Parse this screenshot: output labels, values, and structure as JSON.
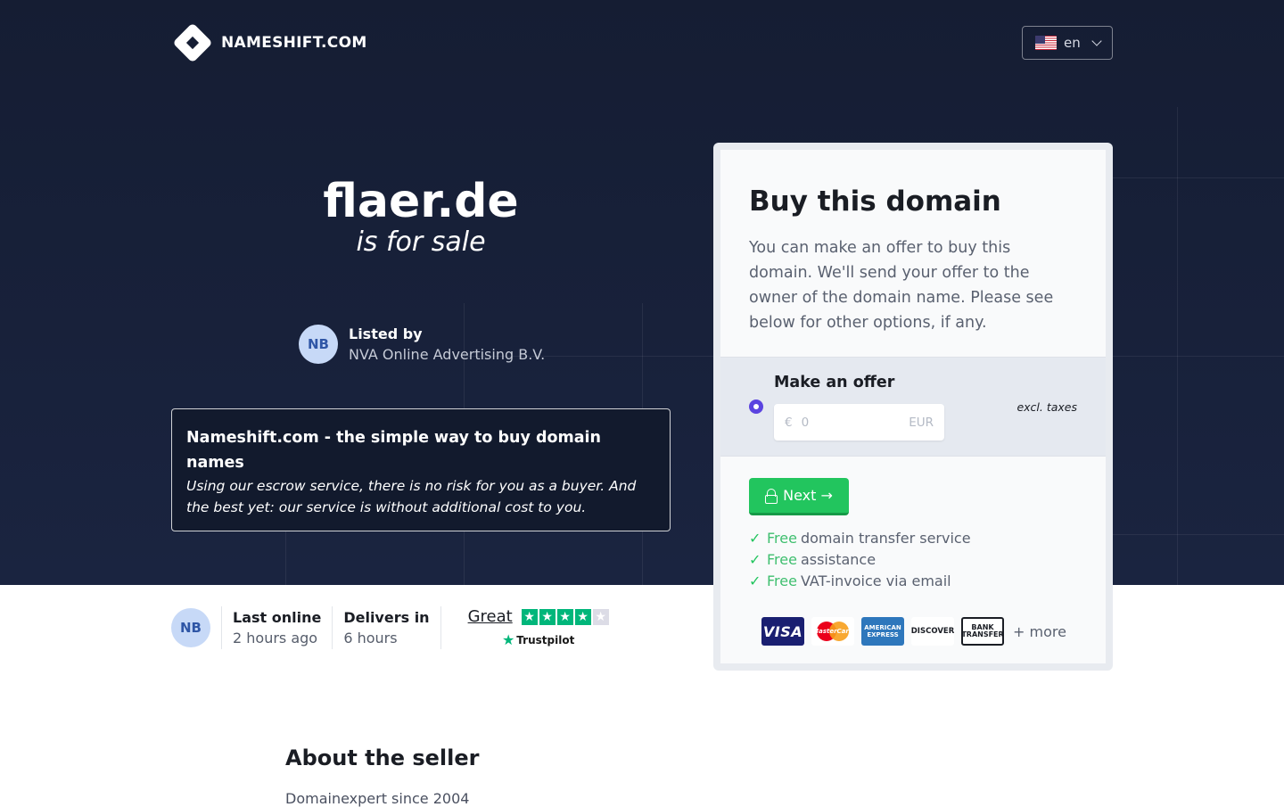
{
  "header": {
    "brand": "NAMESHIFT.COM",
    "language": {
      "code": "en",
      "flag_icon": "us-flag-icon"
    }
  },
  "hero": {
    "domain": "flaer.de",
    "tagline": "is for sale",
    "listed_by_label": "Listed by",
    "seller_name": "NVA Online Advertising B.V.",
    "seller_initials": "NB",
    "promo_title": "Nameshift.com - the simple way to buy domain names",
    "promo_text": "Using our escrow service, there is no risk for you as a buyer. And the best yet: our service is without additional cost to you."
  },
  "stats": {
    "initials": "NB",
    "last_online_label": "Last online",
    "last_online_value": "2 hours ago",
    "delivers_label": "Delivers in",
    "delivers_value": "6 hours",
    "trust_rating": "Great",
    "trust_stars": 4,
    "trust_stars_max": 5,
    "trust_brand": "Trustpilot"
  },
  "card": {
    "title": "Buy this domain",
    "description": "You can make an offer to buy this domain. We'll send your offer to the owner of the domain name. Please see below for other options, if any.",
    "offer_label": "Make an offer",
    "currency_symbol": "€",
    "offer_placeholder": "0",
    "currency_code": "EUR",
    "taxes_note": "excl. taxes",
    "next_button": "Next →",
    "features": [
      {
        "free": "Free",
        "text": "domain transfer service"
      },
      {
        "free": "Free",
        "text": "assistance"
      },
      {
        "free": "Free",
        "text": "VAT-invoice via email"
      }
    ],
    "payments": {
      "visa": "VISA",
      "mastercard": "MasterCard",
      "amex": "AMERICAN EXPRESS",
      "discover": "DISCOVER",
      "bank": "BANK TRANSFER",
      "more": "+ more"
    }
  },
  "about": {
    "title": "About the seller",
    "text": "Domainexpert since 2004"
  },
  "colors": {
    "hero_bg": "#151d33",
    "accent_green": "#22c55e",
    "radio_purple": "#5b44e0",
    "trustpilot_green": "#00b67a"
  }
}
